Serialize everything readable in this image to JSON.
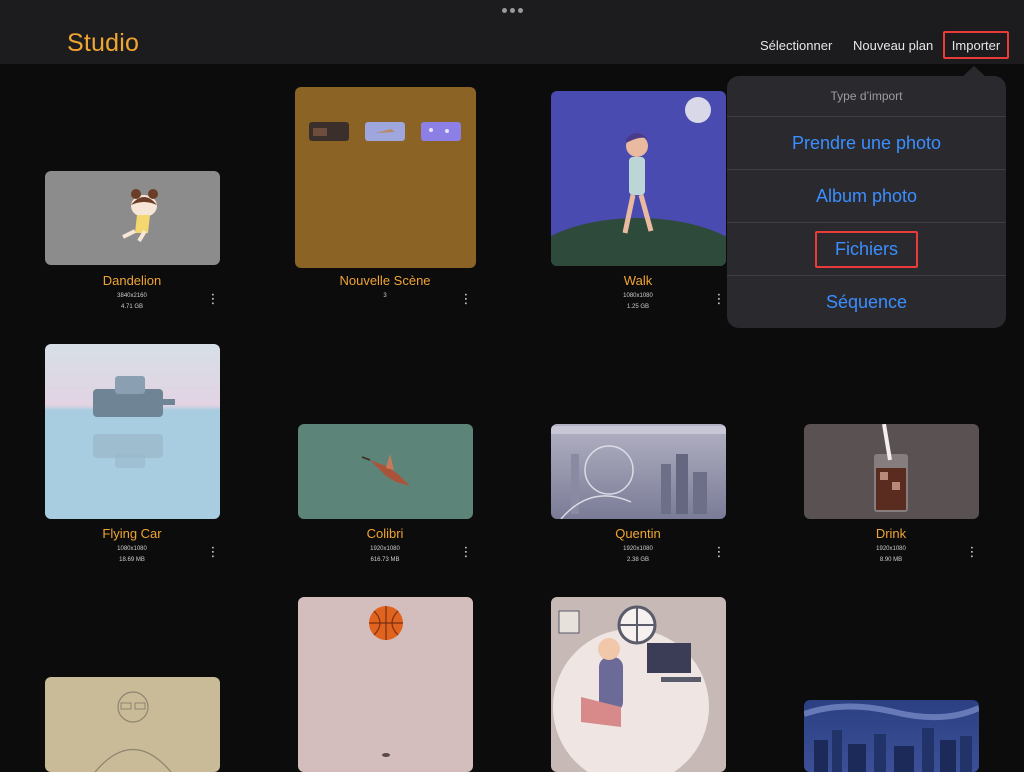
{
  "header": {
    "title": "Studio",
    "select_label": "Sélectionner",
    "new_plan_label": "Nouveau plan",
    "import_label": "Importer"
  },
  "projects": [
    {
      "name": "Dandelion",
      "resolution": "3840x2160",
      "size": "4.71 GB"
    },
    {
      "name": "Nouvelle Scène",
      "count": "3"
    },
    {
      "name": "Walk",
      "resolution": "1080x1080",
      "size": "1.25 GB"
    },
    {
      "name": "Flying Car",
      "resolution": "1080x1080",
      "size": "18.69 MB"
    },
    {
      "name": "Colibri",
      "resolution": "1920x1080",
      "size": "616.73 MB"
    },
    {
      "name": "Quentin",
      "resolution": "1920x1080",
      "size": "2.38 GB"
    },
    {
      "name": "Drink",
      "resolution": "1920x1080",
      "size": "8.90 MB"
    }
  ],
  "more_icon": "⋮",
  "import_menu": {
    "header": "Type d’import",
    "items": [
      "Prendre une photo",
      "Album photo",
      "Fichiers",
      "Séquence"
    ]
  },
  "colors": {
    "accent": "#f0a533",
    "link": "#3b8eff",
    "highlight": "#ea3b3b"
  }
}
